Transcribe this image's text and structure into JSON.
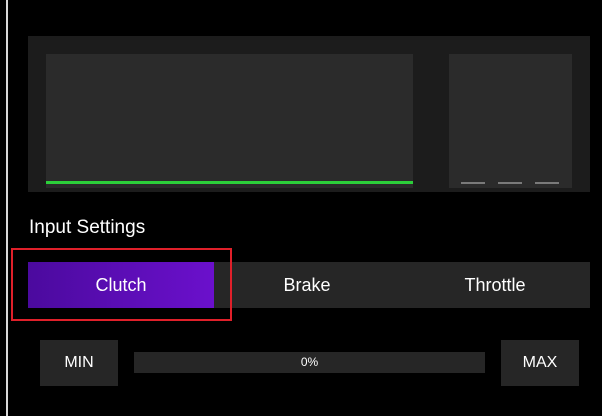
{
  "input_settings": {
    "title": "Input Settings",
    "tabs": [
      {
        "label": "Clutch",
        "selected": true
      },
      {
        "label": "Brake",
        "selected": false
      },
      {
        "label": "Throttle",
        "selected": false
      }
    ]
  },
  "calibration": {
    "min_label": "MIN",
    "max_label": "MAX",
    "progress_text": "0%",
    "progress_fraction": 0
  },
  "colors": {
    "accent": "#6b10cc",
    "graph_line": "#2ccf3a",
    "highlight": "#e0202a",
    "panel": "#1c1c1c",
    "control_bg": "#262626"
  }
}
